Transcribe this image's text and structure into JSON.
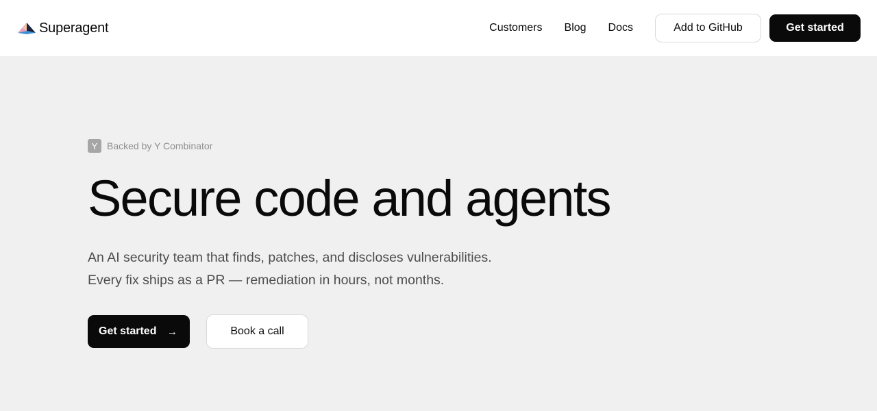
{
  "header": {
    "brand": {
      "name": "Superagent",
      "logo_icon": "pyramid-logo-icon"
    },
    "nav": [
      {
        "label": "Customers"
      },
      {
        "label": "Blog"
      },
      {
        "label": "Docs"
      }
    ],
    "github_button": "Add to GitHub",
    "cta_button": "Get started"
  },
  "hero": {
    "badge": {
      "icon_letter": "Y",
      "text": "Backed by Y Combinator"
    },
    "title": "Secure code and agents",
    "subtitle_lines": [
      "An AI security team that finds, patches, and discloses vulnerabilities.",
      "Every fix ships as a PR — remediation in hours, not months."
    ],
    "primary_button": "Get started",
    "primary_button_icon": "→",
    "secondary_button": "Book a call"
  },
  "colors": {
    "header_bg": "#ffffff",
    "page_bg": "#f0f0f0",
    "primary": "#0a0a0a",
    "badge_bg": "#a6a6a6",
    "muted_text": "#8f8f8f",
    "body_text": "#4d4d4d"
  }
}
